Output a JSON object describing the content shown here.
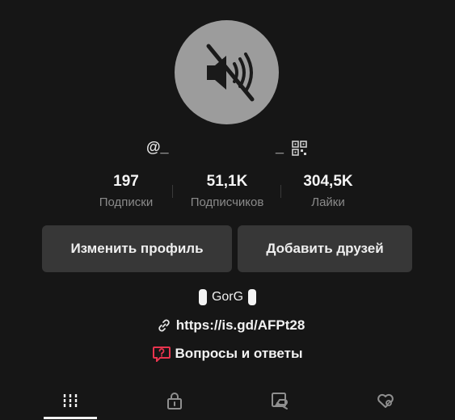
{
  "profile": {
    "handle_prefix": "@_",
    "handle_suffix": "_",
    "stats": [
      {
        "value": "197",
        "label": "Подписки"
      },
      {
        "value": "51,1K",
        "label": "Подписчиков"
      },
      {
        "value": "304,5K",
        "label": "Лайки"
      }
    ],
    "buttons": {
      "edit_label": "Изменить профиль",
      "add_friends_label": "Добавить друзей"
    },
    "bio": "GorG",
    "link": "https://is.gd/AFPt28",
    "qa_label": "Вопросы и ответы"
  },
  "icons": {
    "avatar": "muted-speaker-icon",
    "qr": "qr-code-icon",
    "link": "link-icon",
    "qa": "question-bubble-icon",
    "tabs": [
      "grid-icon",
      "lock-icon",
      "repost-icon",
      "liked-icon"
    ]
  },
  "colors": {
    "background": "#161616",
    "button": "#373737",
    "muted_text": "#8a8a8a",
    "qa_accent": "#e8344e"
  }
}
